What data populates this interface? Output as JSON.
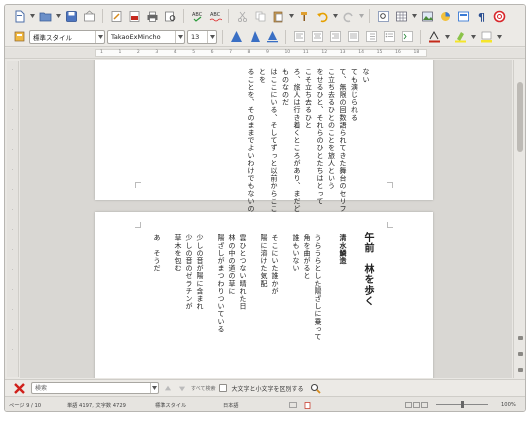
{
  "formatting": {
    "paragraph_style": "標準スタイル",
    "font_name": "TakaoExMincho",
    "font_size": "13"
  },
  "ruler": {
    "ticks": [
      "1",
      "1",
      "2",
      "3",
      "4",
      "5",
      "6",
      "7",
      "8",
      "9",
      "10",
      "11",
      "12",
      "13",
      "14",
      "15",
      "16",
      "18"
    ]
  },
  "page1": {
    "columns": [
      "ない",
      "ても演じられる",
      "て、無限の回数語られてきた舞台のセリフ",
      "こ立ち去るひとのことを旅人という",
      "をせるひと、それらのひとたちはとって",
      "こそ立ち去るひと",
      "ろ、旅人は行き着くところがあり、まだどこ",
      "ものなのだ",
      "はここにいる、そしてずっと以前からここにいる",
      "とを",
      "ることを、そのままでよいわけでもないのに"
    ]
  },
  "page2": {
    "title": "午前　林を歩く",
    "author": "清水鱗造",
    "columns": [
      "うらうらとした陽ざしに乗って",
      "角を曲がると",
      "誰もいない",
      "そこにいた誰かが",
      "陽に溶けた気配",
      "雲ひとつない晴れた日",
      "林の中の道の草に",
      "陽ざしがまつわりついている",
      "少しの音が陽に含まれ",
      "少しの音のゼラチンが",
      "草木を包む",
      "あ　そうだ"
    ]
  },
  "findbar": {
    "placeholder": "検索",
    "find_all": "すべて検索",
    "match_case": "大文字と小文字を区別する"
  },
  "statusbar": {
    "page": "ページ 9 / 10",
    "words": "単語 4197, 文字数 4729",
    "style": "標準スタイル",
    "language": "日本語",
    "zoom": "100%"
  },
  "colors": {
    "chrome": "#e9e7e3",
    "document_background": "#d9d7d3",
    "close_red": "#d0201b"
  }
}
